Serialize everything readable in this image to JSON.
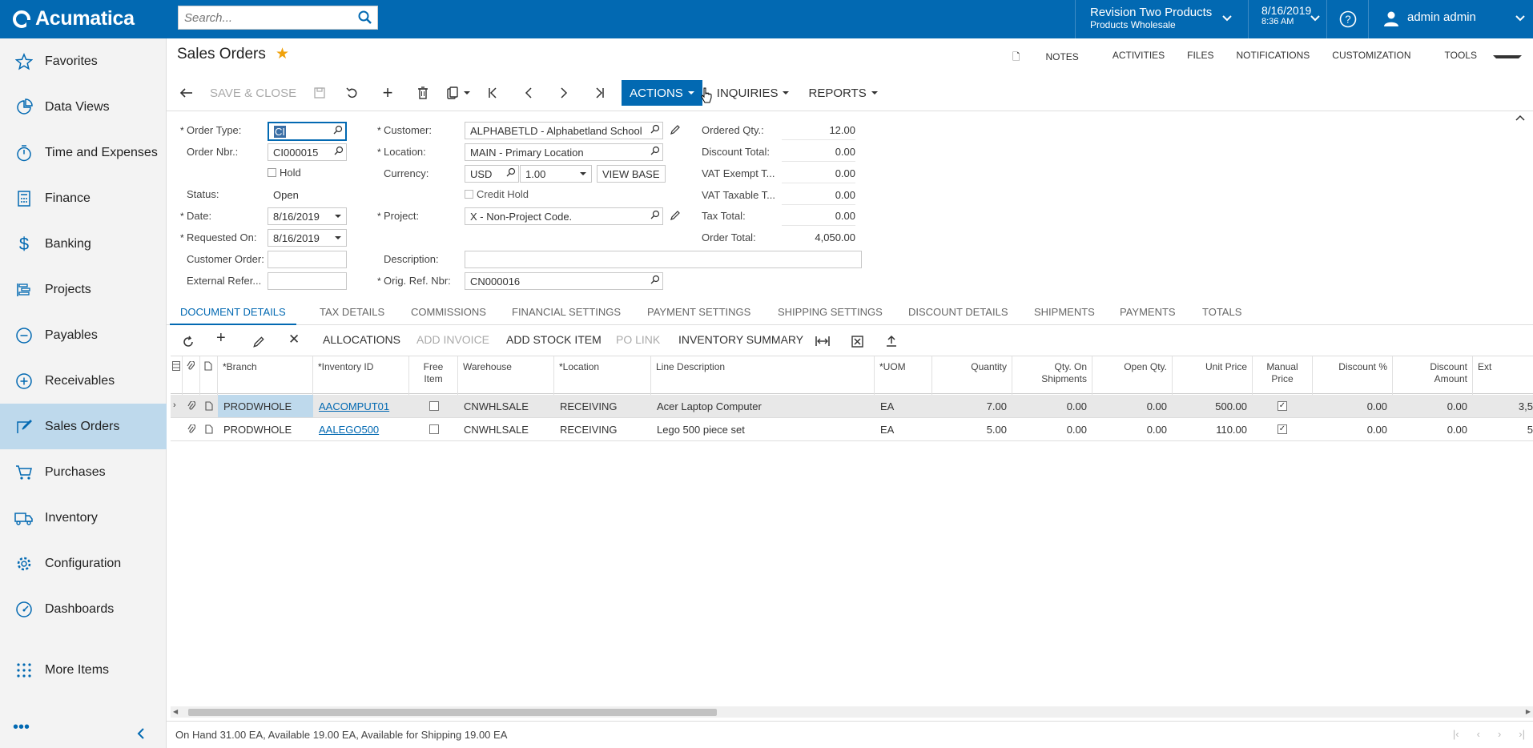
{
  "app": {
    "logo": "Acumatica",
    "search_placeholder": "Search..."
  },
  "header": {
    "company_line1": "Revision Two Products",
    "company_line2": "Products Wholesale",
    "date": "8/16/2019",
    "time": "8:36 AM",
    "user": "admin admin"
  },
  "sidebar": {
    "items": [
      {
        "label": "Favorites",
        "icon": "star-icon"
      },
      {
        "label": "Data Views",
        "icon": "data-views-icon"
      },
      {
        "label": "Time and Expenses",
        "icon": "stopwatch-icon"
      },
      {
        "label": "Finance",
        "icon": "calculator-icon"
      },
      {
        "label": "Banking",
        "icon": "dollar-icon"
      },
      {
        "label": "Projects",
        "icon": "projects-icon"
      },
      {
        "label": "Payables",
        "icon": "minus-circle-icon"
      },
      {
        "label": "Receivables",
        "icon": "plus-circle-icon"
      },
      {
        "label": "Sales Orders",
        "icon": "sales-orders-icon"
      },
      {
        "label": "Purchases",
        "icon": "cart-icon"
      },
      {
        "label": "Inventory",
        "icon": "truck-icon"
      },
      {
        "label": "Configuration",
        "icon": "gear-icon"
      },
      {
        "label": "Dashboards",
        "icon": "gauge-icon"
      },
      {
        "label": "More Items",
        "icon": "grid-dots-icon"
      }
    ],
    "active": "Sales Orders"
  },
  "page": {
    "title": "Sales Orders",
    "top_links": [
      "NOTES",
      "ACTIVITIES",
      "FILES",
      "NOTIFICATIONS",
      "CUSTOMIZATION",
      "TOOLS"
    ],
    "toolbar": {
      "save_close": "SAVE & CLOSE",
      "actions": "ACTIONS",
      "inquiries": "INQUIRIES",
      "reports": "REPORTS"
    }
  },
  "form": {
    "order_type_label": "Order Type:",
    "order_type_value": "CI",
    "order_nbr_label": "Order Nbr.:",
    "order_nbr_value": "CI000015",
    "hold_label": "Hold",
    "status_label": "Status:",
    "status_value": "Open",
    "date_label": "Date:",
    "date_value": "8/16/2019",
    "requested_on_label": "Requested On:",
    "requested_on_value": "8/16/2019",
    "customer_order_label": "Customer Order:",
    "customer_order_value": "",
    "external_ref_label": "External Refer...",
    "external_ref_value": "",
    "customer_label": "Customer:",
    "customer_value": "ALPHABETLD - Alphabetland School",
    "location_label": "Location:",
    "location_value": "MAIN - Primary Location",
    "currency_label": "Currency:",
    "currency_value": "USD",
    "rate_value": "1.00",
    "view_base": "VIEW BASE",
    "credit_hold_label": "Credit Hold",
    "project_label": "Project:",
    "project_value": "X - Non-Project Code.",
    "description_label": "Description:",
    "description_value": "",
    "orig_ref_label": "Orig. Ref. Nbr:",
    "orig_ref_value": "CN000016",
    "ordered_qty_label": "Ordered Qty.:",
    "ordered_qty_value": "12.00",
    "discount_total_label": "Discount Total:",
    "discount_total_value": "0.00",
    "vat_exempt_label": "VAT Exempt T...",
    "vat_exempt_value": "0.00",
    "vat_taxable_label": "VAT Taxable T...",
    "vat_taxable_value": "0.00",
    "tax_total_label": "Tax Total:",
    "tax_total_value": "0.00",
    "order_total_label": "Order Total:",
    "order_total_value": "4,050.00"
  },
  "tabs": [
    "DOCUMENT DETAILS",
    "TAX DETAILS",
    "COMMISSIONS",
    "FINANCIAL SETTINGS",
    "PAYMENT SETTINGS",
    "SHIPPING SETTINGS",
    "DISCOUNT DETAILS",
    "SHIPMENTS",
    "PAYMENTS",
    "TOTALS"
  ],
  "grid_toolbar": {
    "allocations": "ALLOCATIONS",
    "add_invoice": "ADD INVOICE",
    "add_stock_item": "ADD STOCK ITEM",
    "po_link": "PO LINK",
    "inventory_summary": "INVENTORY SUMMARY"
  },
  "grid": {
    "headers": {
      "branch": "Branch",
      "inventory_id": "Inventory ID",
      "free_item_1": "Free",
      "free_item_2": "Item",
      "warehouse": "Warehouse",
      "location": "Location",
      "line_description": "Line Description",
      "uom": "UOM",
      "quantity": "Quantity",
      "qty_on_shipments_1": "Qty. On",
      "qty_on_shipments_2": "Shipments",
      "open_qty": "Open Qty.",
      "unit_price": "Unit Price",
      "manual_price_1": "Manual",
      "manual_price_2": "Price",
      "discount_pct": "Discount %",
      "discount_amount_1": "Discount",
      "discount_amount_2": "Amount",
      "ext": "Ext"
    },
    "rows": [
      {
        "branch": "PRODWHOLE",
        "inventory_id": "AACOMPUT01",
        "warehouse": "CNWHLSALE",
        "location": "RECEIVING",
        "description": "Acer Laptop Computer",
        "uom": "EA",
        "quantity": "7.00",
        "qty_on_shipments": "0.00",
        "open_qty": "0.00",
        "unit_price": "500.00",
        "discount_pct": "0.00",
        "discount_amount": "0.00",
        "ext": "3,5"
      },
      {
        "branch": "PRODWHOLE",
        "inventory_id": "AALEGO500",
        "warehouse": "CNWHLSALE",
        "location": "RECEIVING",
        "description": "Lego 500 piece set",
        "uom": "EA",
        "quantity": "5.00",
        "qty_on_shipments": "0.00",
        "open_qty": "0.00",
        "unit_price": "110.00",
        "discount_pct": "0.00",
        "discount_amount": "0.00",
        "ext": "5"
      }
    ]
  },
  "footer": {
    "status": "On Hand 31.00 EA, Available 19.00 EA, Available for Shipping 19.00 EA"
  },
  "colors": {
    "brand": "#0269b2",
    "active_nav": "#bed9ec",
    "favorite_star": "#f0a20c"
  }
}
